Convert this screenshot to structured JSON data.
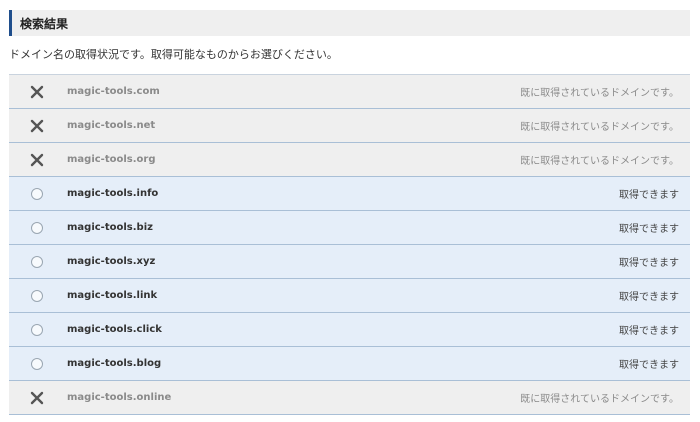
{
  "header": {
    "title": "検索結果"
  },
  "description": "ドメイン名の取得状況です。取得可能なものからお選びください。",
  "results": [
    {
      "domain": "magic-tools.com",
      "status": "既に取得されているドメインです。",
      "available": false
    },
    {
      "domain": "magic-tools.net",
      "status": "既に取得されているドメインです。",
      "available": false
    },
    {
      "domain": "magic-tools.org",
      "status": "既に取得されているドメインです。",
      "available": false
    },
    {
      "domain": "magic-tools.info",
      "status": "取得できます",
      "available": true
    },
    {
      "domain": "magic-tools.biz",
      "status": "取得できます",
      "available": true
    },
    {
      "domain": "magic-tools.xyz",
      "status": "取得できます",
      "available": true
    },
    {
      "domain": "magic-tools.link",
      "status": "取得できます",
      "available": true
    },
    {
      "domain": "magic-tools.click",
      "status": "取得できます",
      "available": true
    },
    {
      "domain": "magic-tools.blog",
      "status": "取得できます",
      "available": true
    },
    {
      "domain": "magic-tools.online",
      "status": "既に取得されているドメインです。",
      "available": false
    }
  ],
  "colors": {
    "accent": "#1f4e8c",
    "taken_row": "#efefef",
    "available_row": "#e5eef9"
  }
}
